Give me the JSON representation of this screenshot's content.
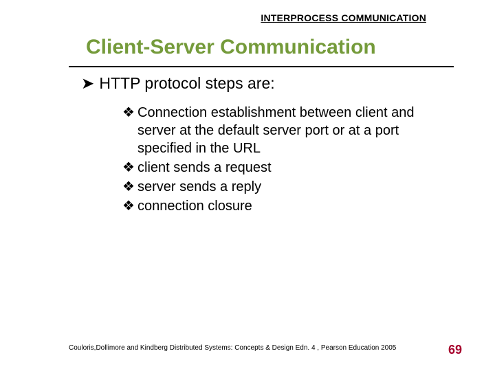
{
  "header": {
    "label": "INTERPROCESS COMMUNICATION"
  },
  "title": "Client-Server Communication",
  "bullets": {
    "lvl1_glyph": "➤",
    "lvl2_glyph": "❖",
    "main": "HTTP protocol steps are:",
    "sub": [
      "Connection establishment between client and server at the default server port or at a port specified in the URL",
      "client sends a request",
      "server sends a reply",
      "connection closure"
    ]
  },
  "footer": {
    "citation": "Couloris,Dollimore and Kindberg  Distributed Systems: Concepts & Design  Edn. 4 ,  Pearson Education 2005",
    "page": "69"
  },
  "colors": {
    "title": "#759b3b",
    "page_num": "#a7002d"
  }
}
